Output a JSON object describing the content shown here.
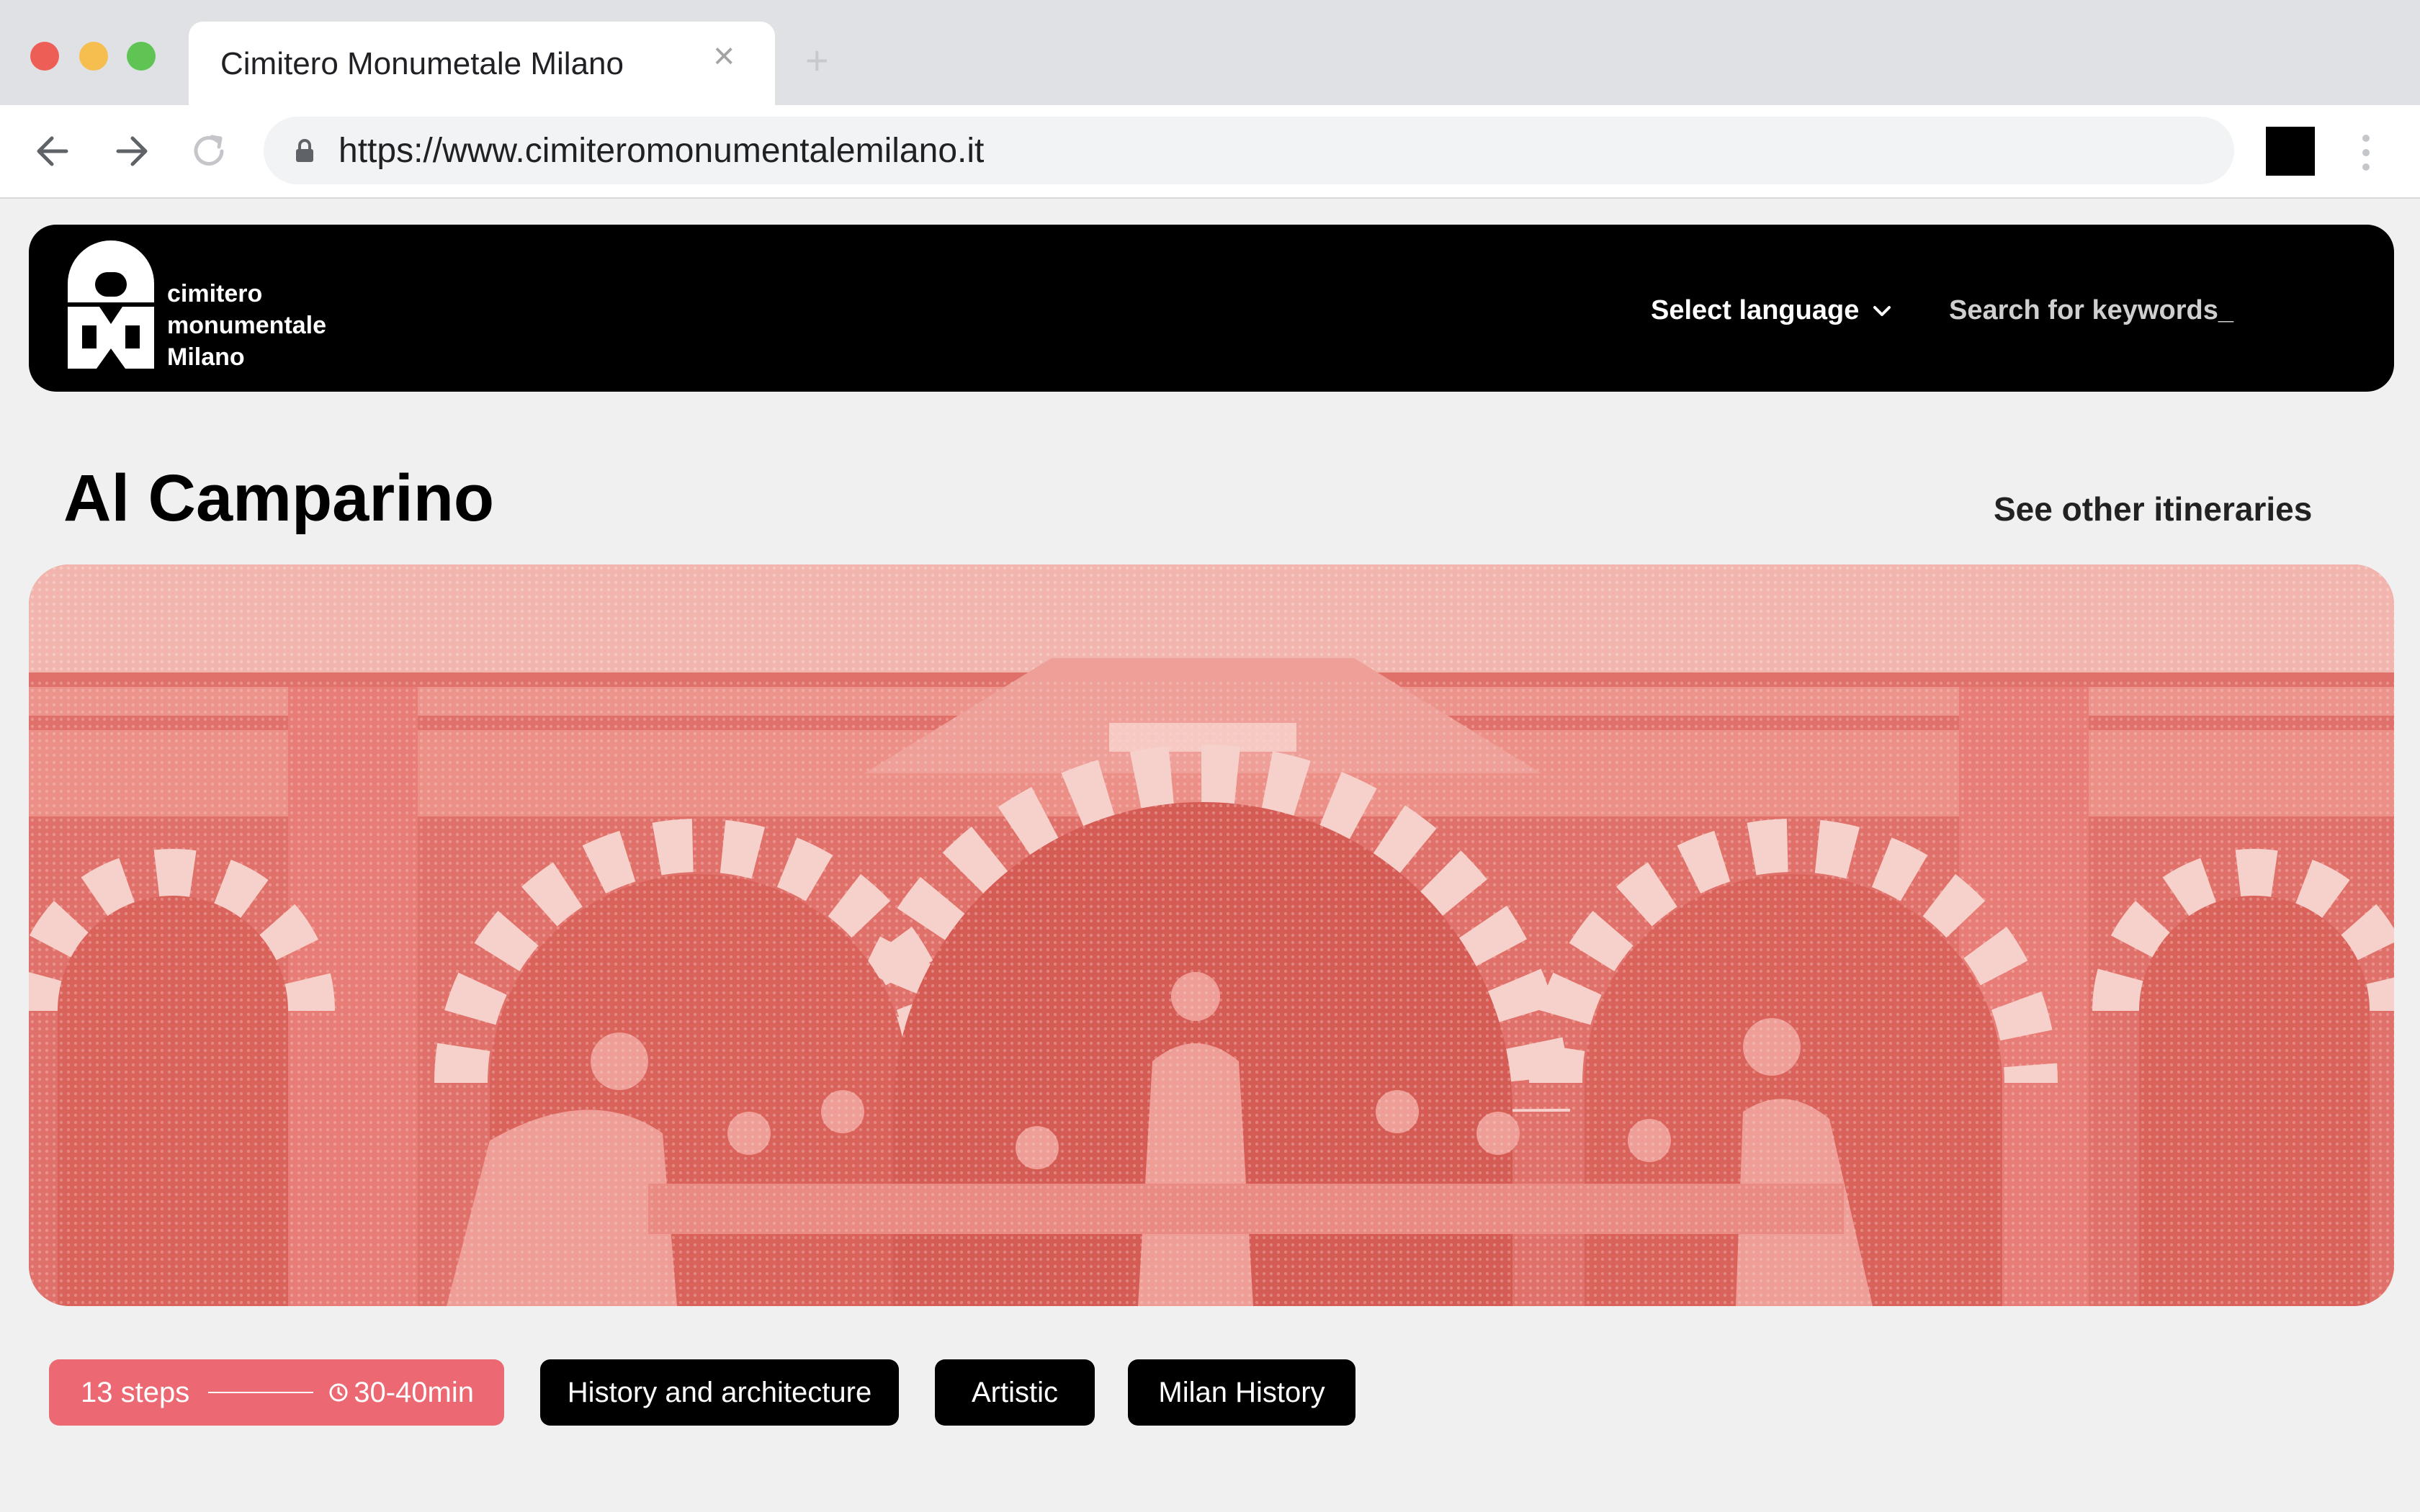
{
  "browser": {
    "tab_title": "Cimitero Monumetale Milano",
    "tab_close_glyph": "×",
    "new_tab_glyph": "+",
    "url": "https://www.cimiteromonumentalemilano.it",
    "icons": [
      "back-arrow-icon",
      "forward-arrow-icon",
      "reload-icon",
      "lock-icon",
      "kebab-menu-icon"
    ]
  },
  "header": {
    "logo_lines": [
      "cimitero",
      "monumentale",
      "Milano"
    ],
    "language_label": "Select language",
    "search_placeholder": "Search for keywords_"
  },
  "page": {
    "title": "Al Camparino",
    "see_other_link": "See other itineraries"
  },
  "hero": {
    "tint_color": "#e06a63",
    "icon": "halftone-sculpture-image"
  },
  "tags": {
    "steps_label": "13 steps",
    "duration": "30-40min",
    "steps_color": "#ec6872",
    "categories": [
      "History and architecture",
      "Artistic",
      "Milan History"
    ]
  }
}
